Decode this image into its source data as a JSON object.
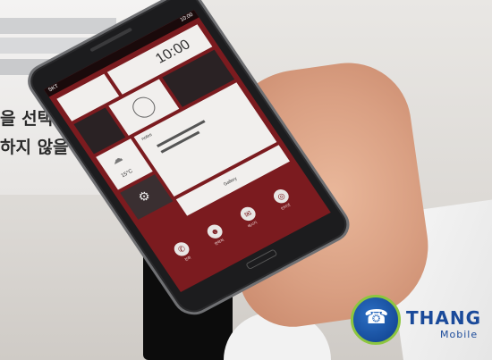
{
  "sign": {
    "line1": "을 선택하여",
    "line2": "하지 않을"
  },
  "phone": {
    "status_carrier": "SKT",
    "status_time": "10:00",
    "clock_time": "10:00",
    "weather_temp": "15°C",
    "note_title": "notes",
    "gallery_label": "Gallery",
    "dock": [
      {
        "label": "전화",
        "icon": "phone-icon",
        "glyph": "✆"
      },
      {
        "label": "연락처",
        "icon": "contacts-icon",
        "glyph": "☻"
      },
      {
        "label": "메시지",
        "icon": "message-icon",
        "glyph": "✉"
      },
      {
        "label": "인터넷",
        "icon": "globe-icon",
        "glyph": "◎"
      }
    ]
  },
  "logo": {
    "title": "THANG",
    "subtitle": "Mobile"
  },
  "colors": {
    "screen_red": "#7b1b1f",
    "logo_blue": "#1a4a9a",
    "logo_green": "#8dc63f"
  }
}
